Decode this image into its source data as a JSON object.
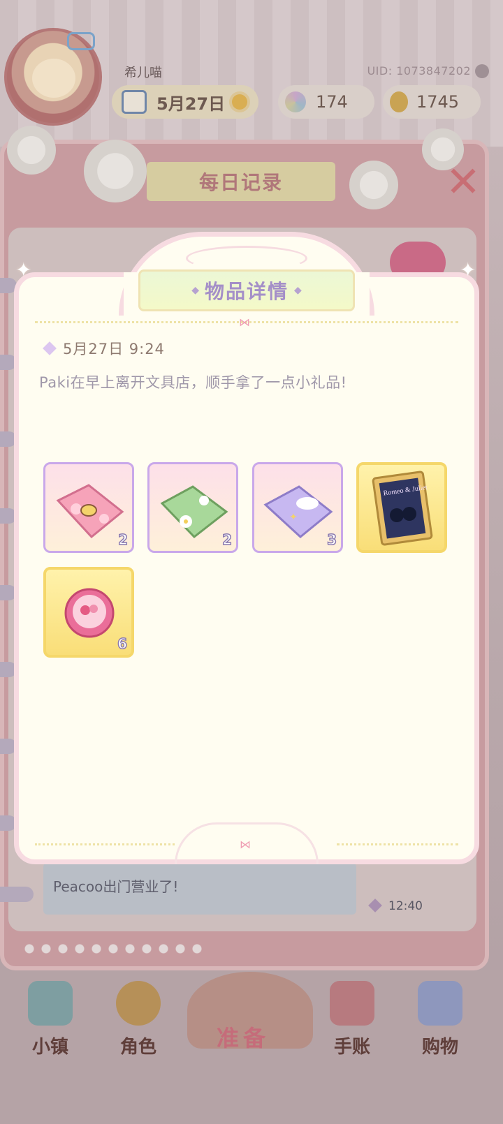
{
  "header": {
    "nickname": "希儿喵",
    "uid": "UID: 1073847202",
    "date": "5月27日",
    "gems": "174",
    "coins": "1745"
  },
  "journal": {
    "title": "每日记录",
    "entry_text": "Peacoo出门营业了!",
    "entry_time": "12:40"
  },
  "modal": {
    "title": "物品详情",
    "timestamp": "5月27日 9:24",
    "description": "Paki在早上离开文具店，顺手拿了一点小礼品!",
    "items": [
      {
        "name": "pink-bee-handkerchief",
        "qty": "2",
        "rarity": "purple"
      },
      {
        "name": "green-flower-handkerchief",
        "qty": "2",
        "rarity": "purple"
      },
      {
        "name": "purple-cloud-handkerchief",
        "qty": "3",
        "rarity": "purple"
      },
      {
        "name": "romeo-juliet-book",
        "qty": "",
        "book_title": "Romeo & Juliet",
        "rarity": "gold"
      },
      {
        "name": "pink-badge",
        "qty": "6",
        "rarity": "gold"
      }
    ]
  },
  "nav": {
    "town": "小镇",
    "character": "角色",
    "prepare": "准备",
    "journal": "手账",
    "shop": "购物"
  },
  "colors": {
    "modal_bg": "#fffdf1",
    "modal_border": "#f7dbe1",
    "title_text": "#a48fc8",
    "purple_frame": "#c9a8ea",
    "gold_frame": "#f5d76a"
  }
}
